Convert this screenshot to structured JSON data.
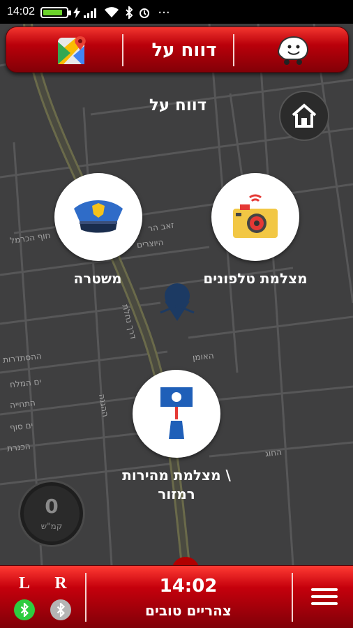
{
  "status_bar": {
    "time": "14:02",
    "battery_level": 0.85,
    "icons": [
      "battery-icon",
      "charging-icon",
      "signal-icon",
      "wifi-icon",
      "bluetooth-icon",
      "alarm-icon",
      "more-icon"
    ],
    "more": "..."
  },
  "top_bar": {
    "title": "דווח על",
    "left_app": "google-maps-icon",
    "right_app": "waze-icon"
  },
  "page": {
    "heading": "דווח על",
    "home_icon": "home-icon"
  },
  "map_streets": [
    "חוף הכרמל",
    "זאב הר",
    "היוצרים",
    "ההסתדרות",
    "ים המלח",
    "התחייה",
    "ים סוף",
    "הכנרת",
    "ההגנה",
    "האומן",
    "דרך נחלת",
    "החוג"
  ],
  "reports": {
    "traffic_camera": {
      "label": "מצלמת טלפונים",
      "icon": "camera-icon"
    },
    "police": {
      "label": "משטרה",
      "icon": "police-hat-icon"
    },
    "speed_camera": {
      "label": "מצלמת מהירות \\",
      "label_line2": "רמזור",
      "icon": "speed-camera-icon"
    }
  },
  "speedometer": {
    "value": "0",
    "unit": "קמ\"ש"
  },
  "bottom_bar": {
    "left_label": "L",
    "right_label": "R",
    "left_bluetooth_connected": true,
    "right_bluetooth_connected": false,
    "clock": "14:02",
    "greeting": "צהריים טובים",
    "menu_icon": "menu-icon"
  },
  "colors": {
    "accent_red": "#c5000c",
    "map_background": "#3f3f40",
    "bluetooth_on": "#2ecc40",
    "bluetooth_off": "#b5b5b5"
  }
}
